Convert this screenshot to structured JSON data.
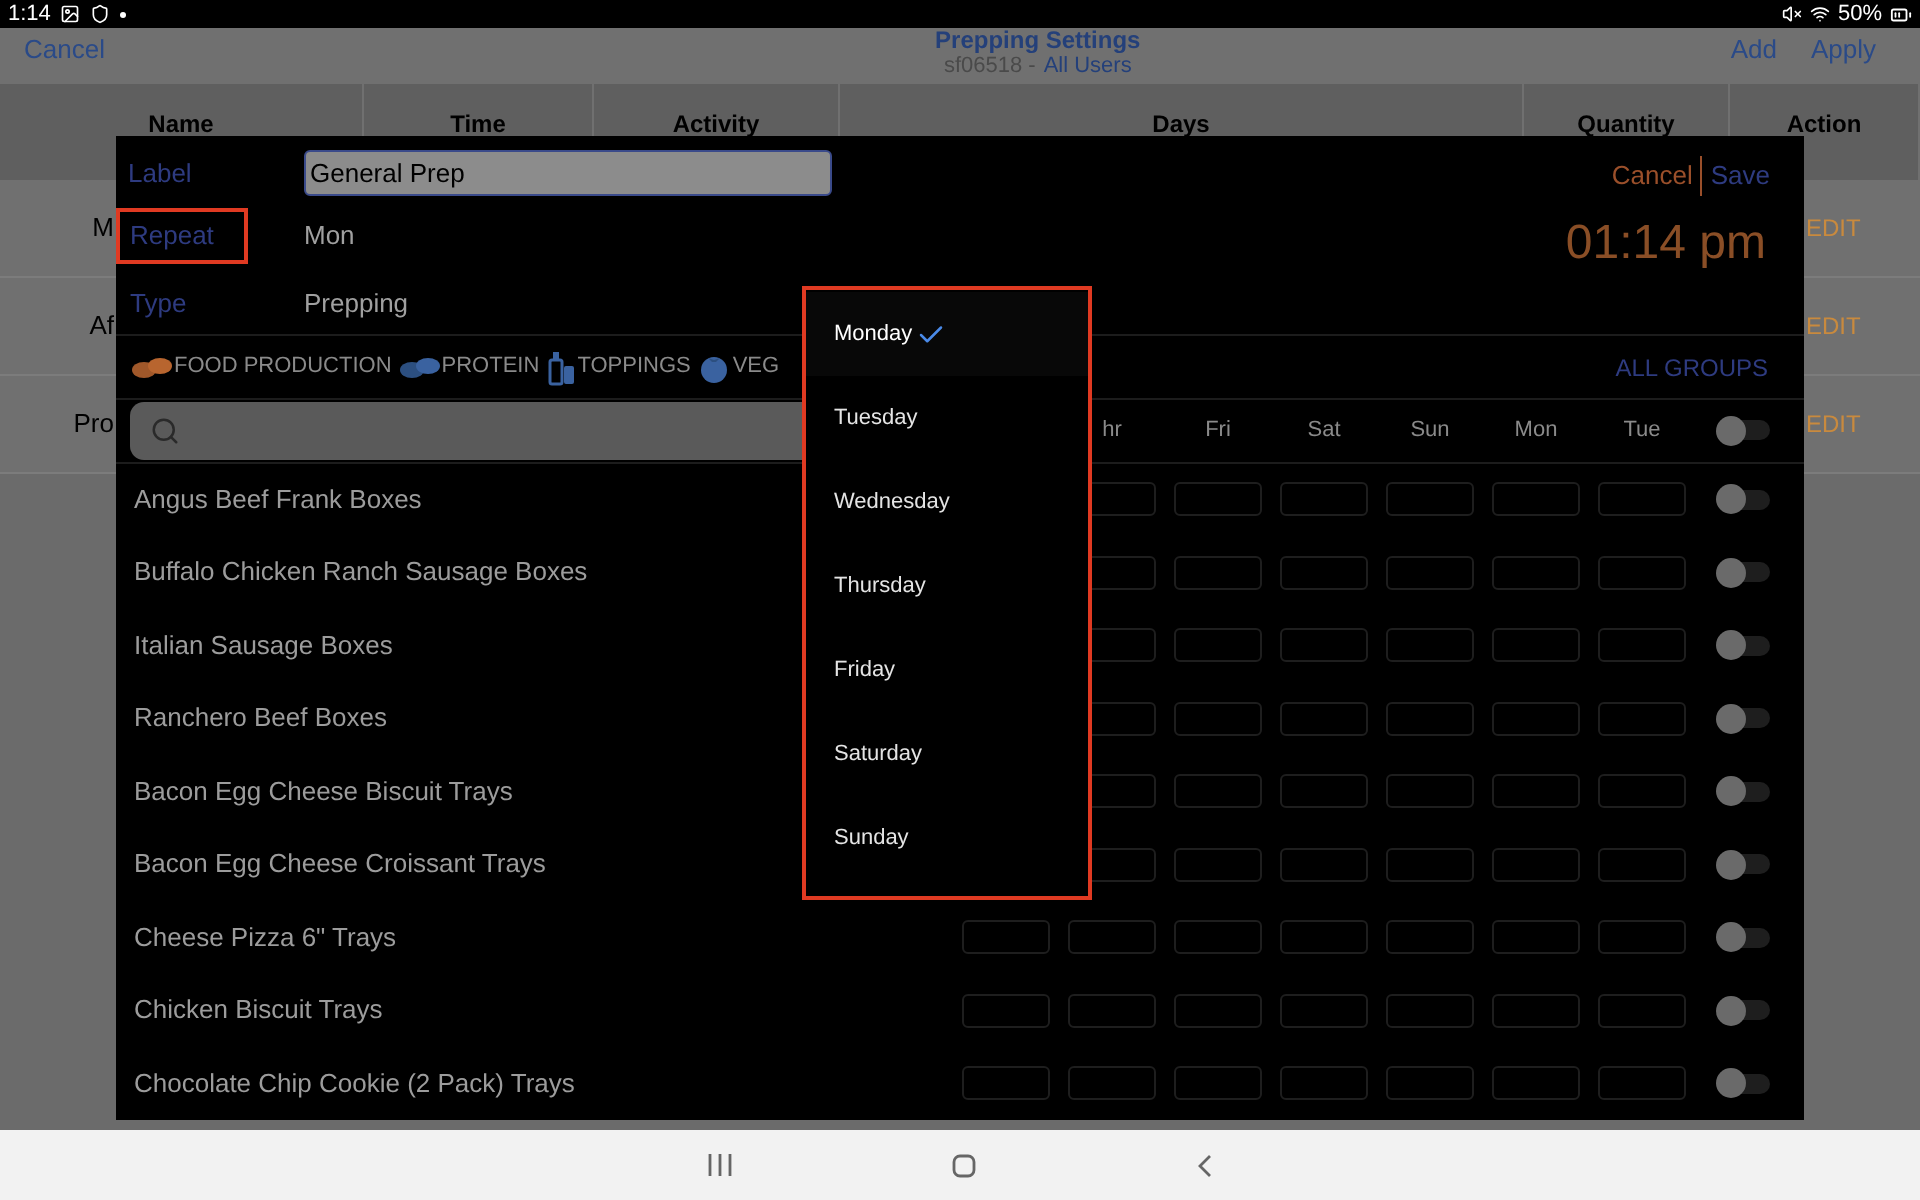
{
  "status_bar": {
    "time": "1:14",
    "battery": "50%"
  },
  "app_bar": {
    "cancel": "Cancel",
    "title": "Prepping Settings",
    "subtitle": "sf06518 -",
    "user_filter": "All Users",
    "add": "Add",
    "apply": "Apply"
  },
  "table": {
    "columns": [
      "Name",
      "Time",
      "Activity",
      "Days",
      "Quantity",
      "Action"
    ],
    "rows": [
      {
        "name": "M",
        "action": "EDIT"
      },
      {
        "name": "Af",
        "action": "EDIT"
      },
      {
        "name": "Pro",
        "action": "EDIT"
      }
    ]
  },
  "dialog": {
    "label": {
      "label": "Label",
      "value": "General Prep"
    },
    "cancel": "Cancel",
    "save": "Save",
    "repeat": {
      "label": "Repeat",
      "value": "Mon",
      "highlighted": true
    },
    "type": {
      "label": "Type",
      "value": "Prepping"
    },
    "time": "01:14 pm",
    "groups": [
      {
        "kind": "food",
        "label": "FOOD PRODUCTION"
      },
      {
        "kind": "protein",
        "label": "PROTEIN"
      },
      {
        "kind": "toppings",
        "label": "TOPPINGS"
      },
      {
        "kind": "veg",
        "label": "VEG"
      }
    ],
    "all_groups": "ALL GROUPS",
    "day_columns": [
      "hr",
      "Fri",
      "Sat",
      "Sun",
      "Mon",
      "Tue"
    ],
    "select_all": {
      "on": false
    },
    "items": [
      {
        "name": "Angus Beef Frank Boxes",
        "on": false
      },
      {
        "name": "Buffalo Chicken Ranch Sausage Boxes",
        "on": false
      },
      {
        "name": "Italian Sausage Boxes",
        "on": false
      },
      {
        "name": "Ranchero Beef Boxes",
        "on": false
      },
      {
        "name": "Bacon Egg Cheese Biscuit Trays",
        "on": false
      },
      {
        "name": "Bacon Egg Cheese Croissant Trays",
        "on": false
      },
      {
        "name": "Cheese Pizza 6\" Trays",
        "on": false
      },
      {
        "name": "Chicken Biscuit Trays",
        "on": false
      },
      {
        "name": "Chocolate Chip Cookie (2 Pack) Trays",
        "on": false
      }
    ]
  },
  "repeat_menu": {
    "highlighted": true,
    "options": [
      {
        "label": "Monday",
        "selected": true
      },
      {
        "label": "Tuesday",
        "selected": false
      },
      {
        "label": "Wednesday",
        "selected": false
      },
      {
        "label": "Thursday",
        "selected": false
      },
      {
        "label": "Friday",
        "selected": false
      },
      {
        "label": "Saturday",
        "selected": false
      },
      {
        "label": "Sunday",
        "selected": false
      }
    ]
  }
}
